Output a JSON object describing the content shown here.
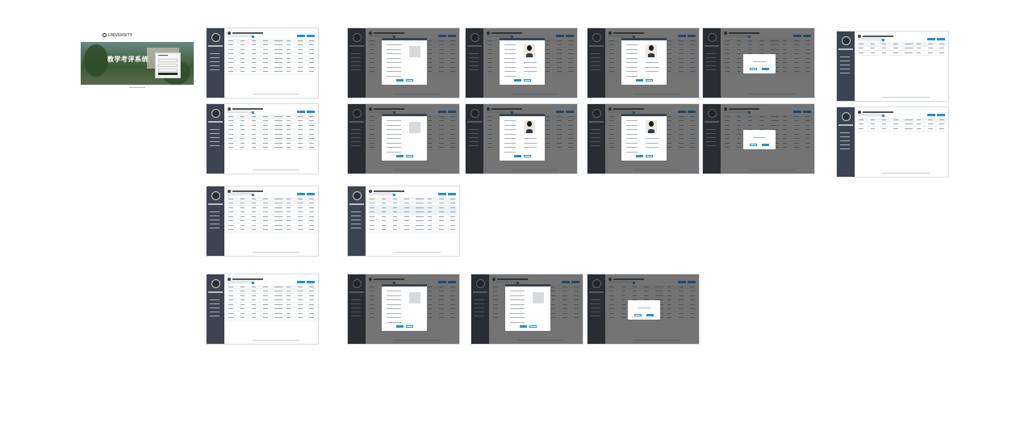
{
  "canvas": {
    "background": "#ffffff"
  },
  "login": {
    "brand": "UNIVERSITY",
    "headline": "教学考评系统"
  },
  "colors": {
    "sidebar": "#3b4450",
    "accent": "#1f8fe0",
    "overlay": "rgba(30,30,30,0.62)"
  },
  "screens": [
    {
      "id": "list-teacher",
      "kind": "list"
    },
    {
      "id": "add-dialog-empty",
      "kind": "modal-form"
    },
    {
      "id": "detail-dialog",
      "kind": "modal-photo"
    },
    {
      "id": "edit-dialog",
      "kind": "modal-photo"
    },
    {
      "id": "confirm-dialog",
      "kind": "modal-confirm"
    },
    {
      "id": "list-compact-1",
      "kind": "list"
    },
    {
      "id": "list-student",
      "kind": "list"
    },
    {
      "id": "add-dialog-2",
      "kind": "modal-form"
    },
    {
      "id": "detail-dialog-2",
      "kind": "modal-photo"
    },
    {
      "id": "edit-dialog-2",
      "kind": "modal-photo"
    },
    {
      "id": "confirm-dialog-2",
      "kind": "modal-confirm"
    },
    {
      "id": "list-compact-2",
      "kind": "list"
    },
    {
      "id": "list-filter",
      "kind": "list"
    },
    {
      "id": "list-filter-selected",
      "kind": "list"
    },
    {
      "id": "list-course",
      "kind": "list"
    },
    {
      "id": "add-dialog-3",
      "kind": "modal-form"
    },
    {
      "id": "edit-dialog-3",
      "kind": "modal-form"
    },
    {
      "id": "confirm-dialog-3",
      "kind": "modal-confirm"
    }
  ]
}
